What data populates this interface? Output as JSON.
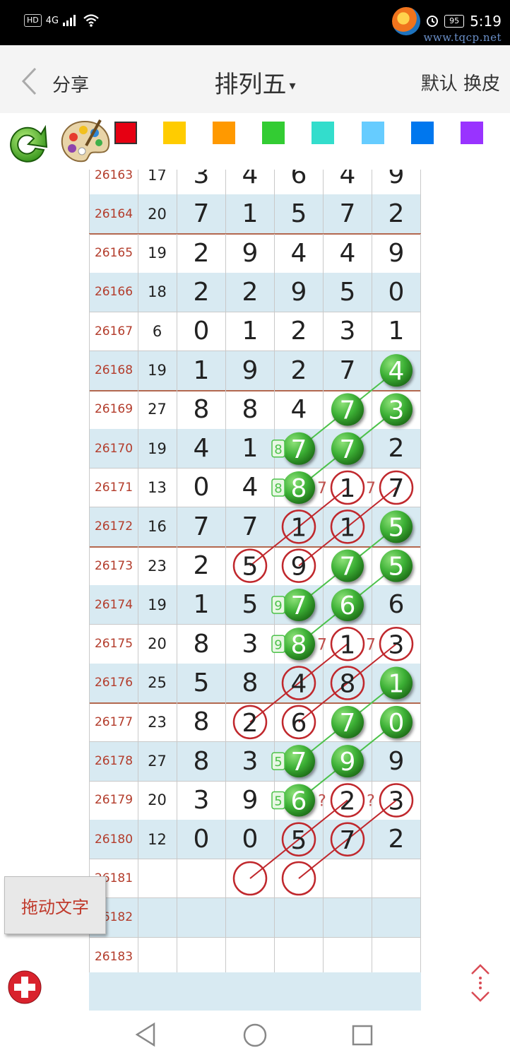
{
  "status_bar": {
    "hd_label": "HD",
    "network_label": "4G",
    "battery": "95",
    "time": "5:19"
  },
  "watermark": {
    "url": "www.tqcp.net"
  },
  "header": {
    "back_icon": "chevron-left-icon",
    "share_label": "分享",
    "title": "排列五",
    "title_caret": "▾",
    "right_label": "默认 换皮"
  },
  "toolbar": {
    "refresh_icon": "refresh-arrow-icon",
    "palette_icon": "paint-palette-icon",
    "colors": [
      "#e60012",
      "#ffcc00",
      "#ff9900",
      "#33cc33",
      "#33ddcc",
      "#66ccff",
      "#0077ee",
      "#9933ff"
    ]
  },
  "table": {
    "rows": [
      {
        "issue": "26163",
        "sum": "17",
        "digits": [
          "3",
          "4",
          "6",
          "4",
          "9"
        ]
      },
      {
        "issue": "26164",
        "sum": "20",
        "digits": [
          "7",
          "1",
          "5",
          "7",
          "2"
        ]
      },
      {
        "issue": "26165",
        "sum": "19",
        "digits": [
          "2",
          "9",
          "4",
          "4",
          "9"
        ]
      },
      {
        "issue": "26166",
        "sum": "18",
        "digits": [
          "2",
          "2",
          "9",
          "5",
          "0"
        ]
      },
      {
        "issue": "26167",
        "sum": "6",
        "digits": [
          "0",
          "1",
          "2",
          "3",
          "1"
        ]
      },
      {
        "issue": "26168",
        "sum": "19",
        "digits": [
          "1",
          "9",
          "2",
          "7",
          "4"
        ]
      },
      {
        "issue": "26169",
        "sum": "27",
        "digits": [
          "8",
          "8",
          "4",
          "7",
          "3"
        ]
      },
      {
        "issue": "26170",
        "sum": "19",
        "digits": [
          "4",
          "1",
          "7",
          "7",
          "2"
        ]
      },
      {
        "issue": "26171",
        "sum": "13",
        "digits": [
          "0",
          "4",
          "8",
          "1",
          "7"
        ]
      },
      {
        "issue": "26172",
        "sum": "16",
        "digits": [
          "7",
          "7",
          "1",
          "1",
          "5"
        ]
      },
      {
        "issue": "26173",
        "sum": "23",
        "digits": [
          "2",
          "5",
          "9",
          "7",
          "5"
        ]
      },
      {
        "issue": "26174",
        "sum": "19",
        "digits": [
          "1",
          "5",
          "7",
          "6",
          "6"
        ]
      },
      {
        "issue": "26175",
        "sum": "20",
        "digits": [
          "8",
          "3",
          "8",
          "1",
          "3"
        ]
      },
      {
        "issue": "26176",
        "sum": "25",
        "digits": [
          "5",
          "8",
          "4",
          "8",
          "1"
        ]
      },
      {
        "issue": "26177",
        "sum": "23",
        "digits": [
          "8",
          "2",
          "6",
          "7",
          "0"
        ]
      },
      {
        "issue": "26178",
        "sum": "27",
        "digits": [
          "8",
          "3",
          "7",
          "9",
          "9"
        ]
      },
      {
        "issue": "26179",
        "sum": "20",
        "digits": [
          "3",
          "9",
          "6",
          "2",
          "3"
        ]
      },
      {
        "issue": "26180",
        "sum": "12",
        "digits": [
          "0",
          "0",
          "5",
          "7",
          "2"
        ]
      },
      {
        "issue": "26181",
        "sum": "",
        "digits": [
          "",
          "",
          "",
          "",
          ""
        ]
      },
      {
        "issue": "26182",
        "sum": "",
        "digits": [
          "",
          "",
          "",
          "",
          ""
        ]
      },
      {
        "issue": "26183",
        "sum": "",
        "digits": [
          "",
          "",
          "",
          "",
          ""
        ]
      }
    ]
  },
  "markers": {
    "green_balls": [
      {
        "row": "26168",
        "col": 4,
        "digit": "4"
      },
      {
        "row": "26169",
        "col": 3,
        "digit": "7"
      },
      {
        "row": "26169",
        "col": 4,
        "digit": "3"
      },
      {
        "row": "26170",
        "col": 2,
        "digit": "7"
      },
      {
        "row": "26170",
        "col": 3,
        "digit": "7"
      },
      {
        "row": "26171",
        "col": 2,
        "digit": "8"
      },
      {
        "row": "26172",
        "col": 4,
        "digit": "5"
      },
      {
        "row": "26173",
        "col": 3,
        "digit": "7"
      },
      {
        "row": "26173",
        "col": 4,
        "digit": "5"
      },
      {
        "row": "26174",
        "col": 2,
        "digit": "7"
      },
      {
        "row": "26174",
        "col": 3,
        "digit": "6"
      },
      {
        "row": "26175",
        "col": 2,
        "digit": "8"
      },
      {
        "row": "26176",
        "col": 4,
        "digit": "1"
      },
      {
        "row": "26177",
        "col": 3,
        "digit": "7"
      },
      {
        "row": "26177",
        "col": 4,
        "digit": "0"
      },
      {
        "row": "26178",
        "col": 2,
        "digit": "7"
      },
      {
        "row": "26178",
        "col": 3,
        "digit": "9"
      },
      {
        "row": "26179",
        "col": 2,
        "digit": "6"
      }
    ],
    "red_rings": [
      {
        "row": "26171",
        "col": 3,
        "digit": "1"
      },
      {
        "row": "26171",
        "col": 4,
        "digit": "7"
      },
      {
        "row": "26172",
        "col": 2,
        "digit": "1"
      },
      {
        "row": "26172",
        "col": 3,
        "digit": "1"
      },
      {
        "row": "26173",
        "col": 1,
        "digit": "5"
      },
      {
        "row": "26173",
        "col": 2,
        "digit": "9"
      },
      {
        "row": "26175",
        "col": 3,
        "digit": "1"
      },
      {
        "row": "26175",
        "col": 4,
        "digit": "3"
      },
      {
        "row": "26176",
        "col": 2,
        "digit": "4"
      },
      {
        "row": "26176",
        "col": 3,
        "digit": "8"
      },
      {
        "row": "26177",
        "col": 1,
        "digit": "2"
      },
      {
        "row": "26177",
        "col": 2,
        "digit": "6"
      },
      {
        "row": "26179",
        "col": 3,
        "digit": "2"
      },
      {
        "row": "26179",
        "col": 4,
        "digit": "3"
      },
      {
        "row": "26180",
        "col": 2,
        "digit": "5"
      },
      {
        "row": "26180",
        "col": 3,
        "digit": "7"
      },
      {
        "row": "26181",
        "col": 1,
        "digit": ""
      },
      {
        "row": "26181",
        "col": 2,
        "digit": ""
      }
    ],
    "small_green_boxes": [
      {
        "row": "26170",
        "text": "8"
      },
      {
        "row": "26171",
        "text": "8"
      },
      {
        "row": "26174",
        "text": "9"
      },
      {
        "row": "26175",
        "text": "9"
      },
      {
        "row": "26178",
        "text": "5"
      },
      {
        "row": "26179",
        "text": "5"
      }
    ],
    "small_red_marks": [
      {
        "row": "26171",
        "after_col": 2,
        "text": "7"
      },
      {
        "row": "26171",
        "after_col": 3,
        "text": "7"
      },
      {
        "row": "26175",
        "after_col": 2,
        "text": "7"
      },
      {
        "row": "26175",
        "after_col": 3,
        "text": "7"
      },
      {
        "row": "26179",
        "after_col": 2,
        "text": "?"
      },
      {
        "row": "26179",
        "after_col": 3,
        "text": "?"
      }
    ],
    "green_lines": [
      [
        [
          "26168",
          4
        ],
        [
          "26170",
          2
        ]
      ],
      [
        [
          "26169",
          4
        ],
        [
          "26171",
          2
        ]
      ],
      [
        [
          "26172",
          4
        ],
        [
          "26174",
          2
        ]
      ],
      [
        [
          "26173",
          4
        ],
        [
          "26175",
          2
        ]
      ],
      [
        [
          "26176",
          4
        ],
        [
          "26178",
          2
        ]
      ],
      [
        [
          "26177",
          4
        ],
        [
          "26179",
          2
        ]
      ]
    ],
    "red_lines": [
      [
        [
          "26171",
          4
        ],
        [
          "26173",
          2
        ]
      ],
      [
        [
          "26171",
          3
        ],
        [
          "26173",
          1
        ]
      ],
      [
        [
          "26175",
          4
        ],
        [
          "26177",
          2
        ]
      ],
      [
        [
          "26175",
          3
        ],
        [
          "26177",
          1
        ]
      ],
      [
        [
          "26179",
          4
        ],
        [
          "26181",
          2
        ]
      ],
      [
        [
          "26179",
          3
        ],
        [
          "26181",
          1
        ]
      ]
    ]
  },
  "floating": {
    "drag_text_label": "拖动文字",
    "add_icon": "plus-circle-icon",
    "scroll_icon": "scroll-up-down-icon"
  },
  "nav_bar": {
    "back_icon": "triangle-back-icon",
    "home_icon": "circle-home-icon",
    "recent_icon": "square-recent-icon"
  }
}
